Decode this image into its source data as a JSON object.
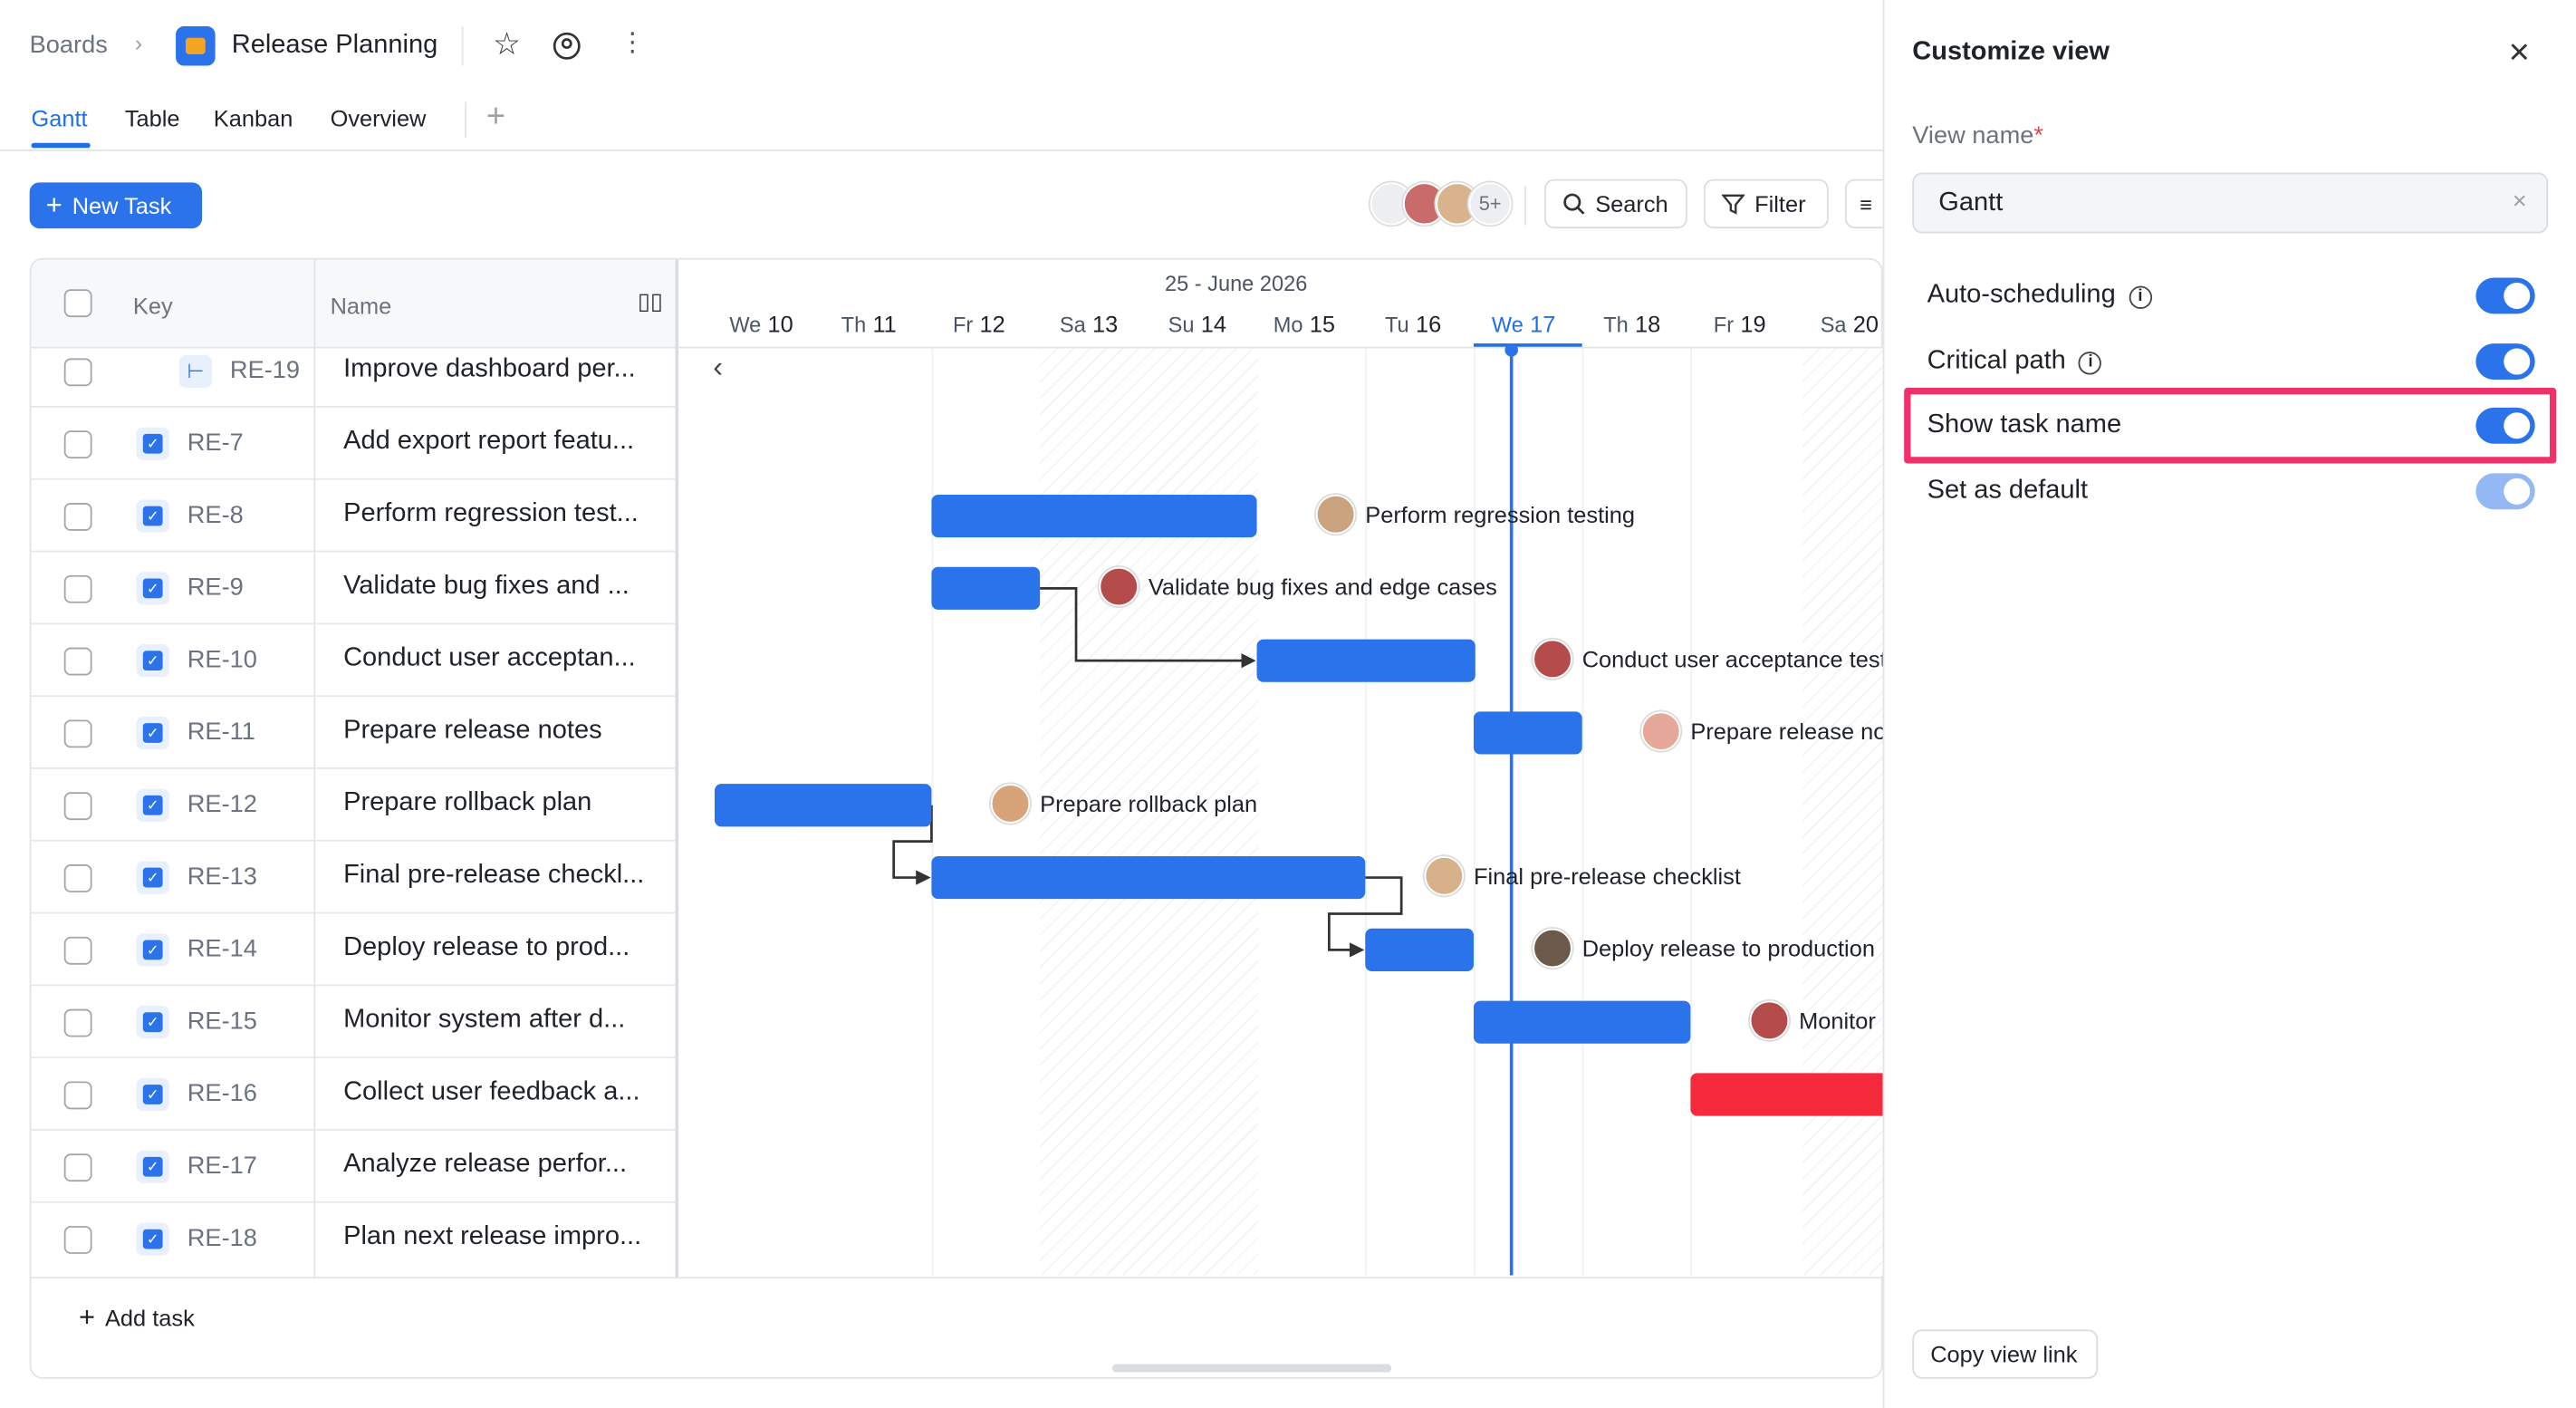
{
  "breadcrumb": {
    "root": "Boards",
    "board_title": "Release Planning"
  },
  "tabs": [
    "Gantt",
    "Table",
    "Kanban",
    "Overview"
  ],
  "toolbar": {
    "new_task": "New Task",
    "avatar_more": "5+",
    "search": "Search",
    "filter": "Filter"
  },
  "columns": {
    "key": "Key",
    "name": "Name"
  },
  "tasks": [
    {
      "key": "RE-19",
      "name": "Improve dashboard per..."
    },
    {
      "key": "RE-7",
      "name": "Add export report featu..."
    },
    {
      "key": "RE-8",
      "name": "Perform regression test..."
    },
    {
      "key": "RE-9",
      "name": "Validate bug fixes and ..."
    },
    {
      "key": "RE-10",
      "name": "Conduct user acceptan..."
    },
    {
      "key": "RE-11",
      "name": "Prepare release notes"
    },
    {
      "key": "RE-12",
      "name": "Prepare rollback plan"
    },
    {
      "key": "RE-13",
      "name": "Final pre-release checkl..."
    },
    {
      "key": "RE-14",
      "name": "Deploy release to prod..."
    },
    {
      "key": "RE-15",
      "name": "Monitor system after d..."
    },
    {
      "key": "RE-16",
      "name": "Collect user feedback a..."
    },
    {
      "key": "RE-17",
      "name": "Analyze release perfor..."
    },
    {
      "key": "RE-18",
      "name": "Plan next release impro..."
    }
  ],
  "add_task": "Add task",
  "timeline": {
    "month_label": "25 - June 2026",
    "days": [
      {
        "dow": "We",
        "num": "10"
      },
      {
        "dow": "Th",
        "num": "11"
      },
      {
        "dow": "Fr",
        "num": "12"
      },
      {
        "dow": "Sa",
        "num": "13"
      },
      {
        "dow": "Su",
        "num": "14"
      },
      {
        "dow": "Mo",
        "num": "15"
      },
      {
        "dow": "Tu",
        "num": "16"
      },
      {
        "dow": "We",
        "num": "17"
      },
      {
        "dow": "Th",
        "num": "18"
      },
      {
        "dow": "Fr",
        "num": "19"
      },
      {
        "dow": "Sa",
        "num": "20"
      }
    ],
    "today": "We 17"
  },
  "gantt_labels": {
    "re8": "Perform regression testing",
    "re9": "Validate bug fixes and edge cases",
    "re10": "Conduct user acceptance test",
    "re11": "Prepare release no",
    "re12": "Prepare rollback plan",
    "re13": "Final pre-release checklist",
    "re14": "Deploy release to production",
    "re15": "Monitor"
  },
  "colors": {
    "accent": "#2a73ea",
    "critical": "#f52a3a",
    "highlight": "#f0306b"
  },
  "panel": {
    "title": "Customize view",
    "view_name_label": "View name",
    "required_mark": "*",
    "view_name_value": "Gantt",
    "options": [
      {
        "label": "Auto-scheduling",
        "on": true
      },
      {
        "label": "Critical path",
        "on": true
      },
      {
        "label": "Show task name",
        "on": true
      },
      {
        "label": "Set as default",
        "on": true
      }
    ],
    "copy_link": "Copy view link"
  }
}
